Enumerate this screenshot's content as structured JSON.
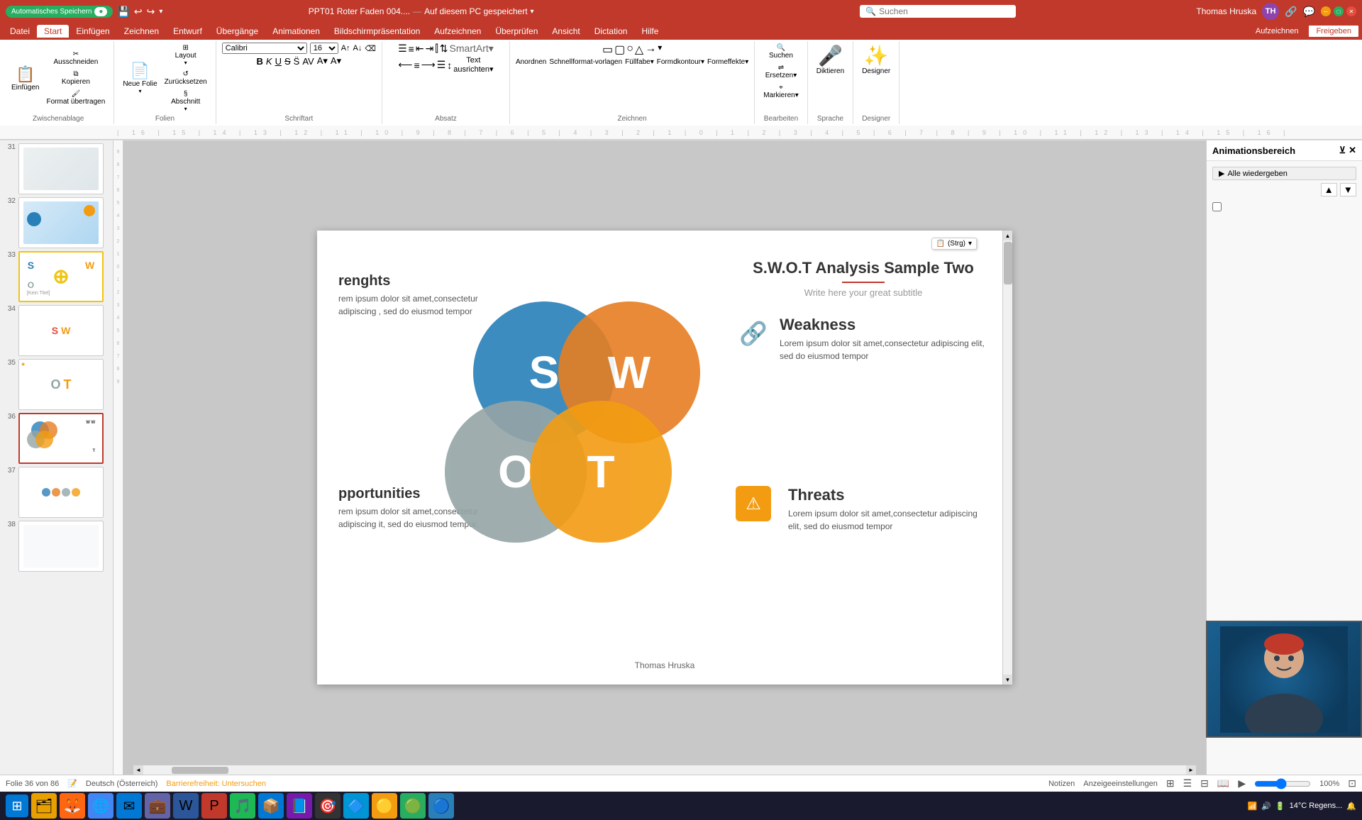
{
  "titlebar": {
    "autosave_label": "Automatisches Speichern",
    "filename": "PPT01 Roter Faden 004....",
    "save_location": "Auf diesem PC gespeichert",
    "search_placeholder": "Suchen",
    "user_name": "Thomas Hruska",
    "user_initials": "TH"
  },
  "ribbon": {
    "tabs": [
      "Datei",
      "Start",
      "Einfügen",
      "Zeichnen",
      "Entwurf",
      "Übergänge",
      "Animationen",
      "Bildschirmpräsentation",
      "Aufzeichnen",
      "Überprüfen",
      "Ansicht",
      "Dictation",
      "Hilfe"
    ],
    "active_tab": "Start",
    "groups": {
      "clipboard": {
        "label": "Zwischenablage",
        "paste_label": "Einfügen",
        "cut_label": "Ausschneiden",
        "copy_label": "Kopieren",
        "format_label": "Format übertragen"
      },
      "slides": {
        "label": "Folien",
        "new_label": "Neue Folie",
        "layout_label": "Layout",
        "reset_label": "Zurücksetzen",
        "section_label": "Abschnitt"
      }
    },
    "aufzeichnen_btn": "Aufzeichnen",
    "freigeben_btn": "Freigeben",
    "diktat_btn": "Diktieren",
    "designer_btn": "Designer"
  },
  "slides": {
    "current": 36,
    "total": 86,
    "items": [
      {
        "num": "31",
        "star": false
      },
      {
        "num": "32",
        "star": false
      },
      {
        "num": "33",
        "star": false
      },
      {
        "num": "34",
        "star": false
      },
      {
        "num": "35",
        "star": true
      },
      {
        "num": "36",
        "star": false,
        "active": true
      },
      {
        "num": "37",
        "star": false
      },
      {
        "num": "38",
        "star": false
      }
    ]
  },
  "slide_content": {
    "title": "S.W.O.T Analysis Sample Two",
    "subtitle": "Write here your great subtitle",
    "strengths_title": "renghts",
    "strengths_text": "rem ipsum dolor sit amet,consectetur adipiscing , sed do eiusmod tempor",
    "weakness_title": "Weakness",
    "weakness_text": "Lorem ipsum dolor sit amet,consectetur adipiscing elit, sed do eiusmod tempor",
    "opportunities_title": "pportunities",
    "opportunities_text": "rem ipsum dolor sit amet,consectetur adipiscing it, sed do eiusmod tempor.",
    "threats_title": "Threats",
    "threats_text": "Lorem ipsum dolor sit amet,consectetur adipiscing elit, sed do eiusmod tempor",
    "swot_s": "S",
    "swot_w": "W",
    "swot_o": "O",
    "swot_t": "T",
    "author": "Thomas Hruska",
    "ctrl_label": "(Strg)"
  },
  "animation_panel": {
    "title": "Animationsbereich",
    "play_label": "Alle wiedergeben"
  },
  "statusbar": {
    "slide_info": "Folie 36 von 86",
    "language": "Deutsch (Österreich)",
    "accessibility": "Barrierefreiheit: Untersuchen",
    "notes": "Notizen",
    "comments": "Anzeigeeinstellungen"
  },
  "taskbar": {
    "time": "14°C Regens...",
    "apps": [
      "⊞",
      "🗂",
      "🦊",
      "🌐",
      "📬",
      "💻",
      "📝",
      "🎵",
      "📦",
      "📋",
      "📘",
      "🎯",
      "🔷",
      "🟡",
      "🟢",
      "🔵"
    ]
  }
}
